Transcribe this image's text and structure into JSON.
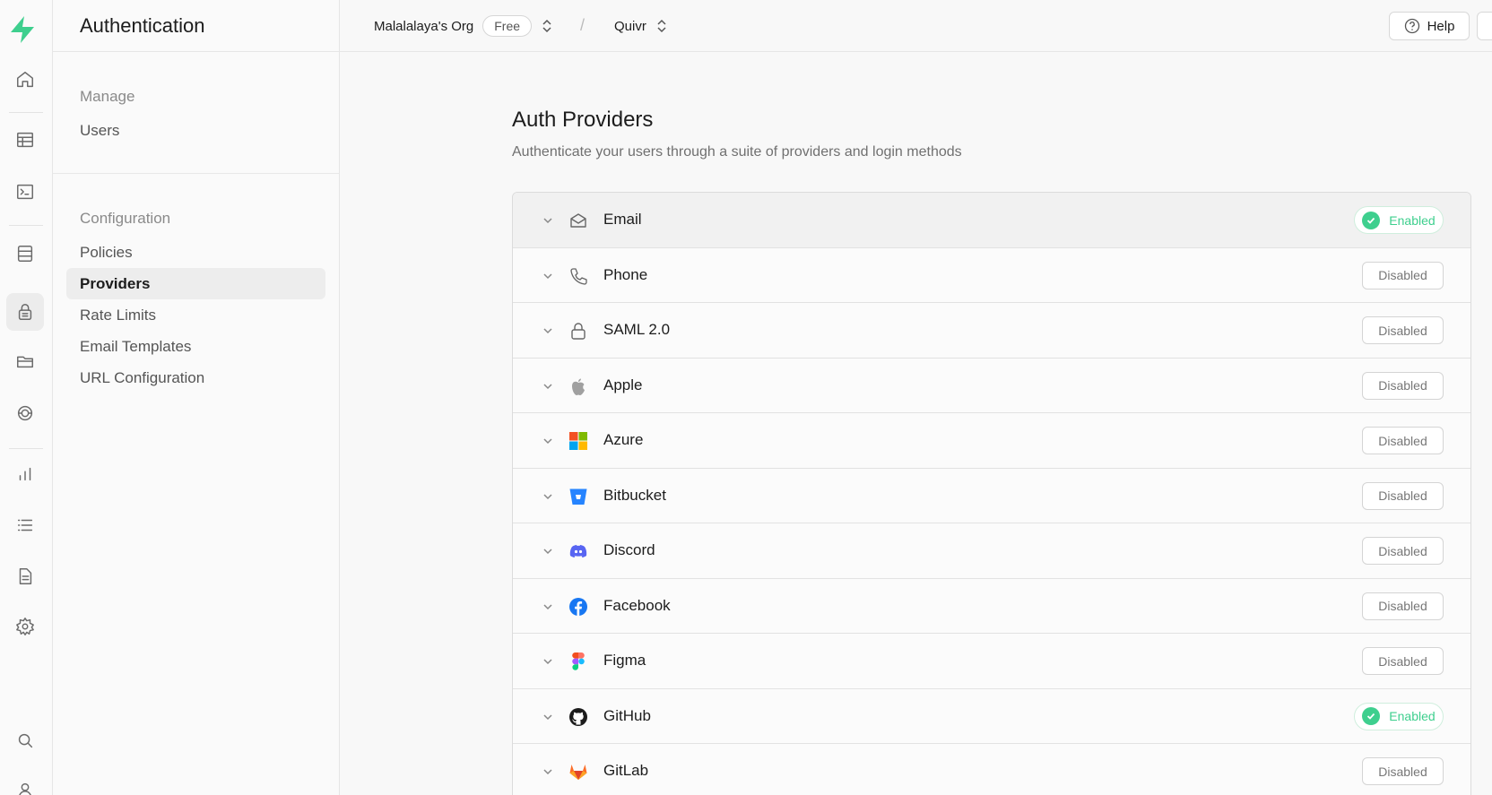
{
  "app": {
    "section_title": "Authentication"
  },
  "rail": {
    "items": [
      "home",
      "table-editor",
      "sql-editor",
      "database",
      "authentication",
      "storage",
      "edge-functions",
      "reports",
      "logs",
      "api-docs",
      "project-settings",
      "search",
      "account"
    ],
    "active": "authentication"
  },
  "menu": {
    "groups": [
      {
        "title": "Manage",
        "items": [
          "Users"
        ]
      },
      {
        "title": "Configuration",
        "items": [
          "Policies",
          "Providers",
          "Rate Limits",
          "Email Templates",
          "URL Configuration"
        ]
      }
    ],
    "active_item": "Providers"
  },
  "topbar": {
    "org_name": "Malalalaya's Org",
    "plan_badge": "Free",
    "separator": "/",
    "project_name": "Quivr",
    "help_label": "Help"
  },
  "main": {
    "title": "Auth Providers",
    "subtitle": "Authenticate your users through a suite of providers and login methods",
    "providers": [
      {
        "name": "Email",
        "status": "Enabled",
        "icon": "envelope-icon"
      },
      {
        "name": "Phone",
        "status": "Disabled",
        "icon": "phone-icon"
      },
      {
        "name": "SAML 2.0",
        "status": "Disabled",
        "icon": "lock-icon"
      },
      {
        "name": "Apple",
        "status": "Disabled",
        "icon": "apple-icon"
      },
      {
        "name": "Azure",
        "status": "Disabled",
        "icon": "microsoft-icon"
      },
      {
        "name": "Bitbucket",
        "status": "Disabled",
        "icon": "bitbucket-icon"
      },
      {
        "name": "Discord",
        "status": "Disabled",
        "icon": "discord-icon"
      },
      {
        "name": "Facebook",
        "status": "Disabled",
        "icon": "facebook-icon"
      },
      {
        "name": "Figma",
        "status": "Disabled",
        "icon": "figma-icon"
      },
      {
        "name": "GitHub",
        "status": "Enabled",
        "icon": "github-icon"
      },
      {
        "name": "GitLab",
        "status": "Disabled",
        "icon": "gitlab-icon"
      }
    ]
  },
  "colors": {
    "brand": "#3ecf8e",
    "enabled": "#3ecf8e",
    "disabled_text": "#777777",
    "azure_red": "#f25022",
    "azure_green": "#7fba00",
    "azure_blue": "#00a4ef",
    "azure_yellow": "#ffb900",
    "bitbucket": "#2684ff",
    "discord": "#5865f2",
    "facebook": "#1877f2",
    "gitlab": "#fc6d26"
  }
}
